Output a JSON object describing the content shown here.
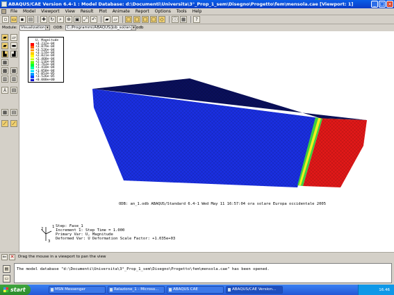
{
  "window": {
    "title": "ABAQUS/CAE Version 6.4-1 : Model Database: d:\\Documenti\\Universita\\3°_Prop_1_sem\\Disegno\\Progetto\\fem\\mensola.cae [Viewport: 1]"
  },
  "menu": [
    "File",
    "Model",
    "Viewport",
    "View",
    "Result",
    "Plot",
    "Animate",
    "Report",
    "Options",
    "Tools",
    "Help"
  ],
  "toolbar": {
    "help_icon": "?"
  },
  "module": {
    "label": "Module:",
    "value": "Visualization",
    "odb_label": "ODB:",
    "odb_value": "C:/Programmi/ABAQUS/Job_sol/an_1.odb"
  },
  "legend": {
    "title": "U, Magnitude",
    "entries": [
      {
        "value": "+4.232e-04",
        "color": "#ff0000"
      },
      {
        "value": "+3.879e-04",
        "color": "#ff5a00"
      },
      {
        "value": "+3.526e-04",
        "color": "#ff9900"
      },
      {
        "value": "+3.174e-04",
        "color": "#ffcc00"
      },
      {
        "value": "+2.821e-04",
        "color": "#ffff00"
      },
      {
        "value": "+2.468e-04",
        "color": "#ccff00"
      },
      {
        "value": "+2.116e-04",
        "color": "#66ff00"
      },
      {
        "value": "+1.763e-04",
        "color": "#00ff33"
      },
      {
        "value": "+1.410e-04",
        "color": "#00ffaa"
      },
      {
        "value": "+1.058e-04",
        "color": "#00e5ff"
      },
      {
        "value": "+7.053e-05",
        "color": "#0099ff"
      },
      {
        "value": "+3.526e-05",
        "color": "#0044ff"
      },
      {
        "value": "+0.000e+00",
        "color": "#0000cc"
      }
    ]
  },
  "info": {
    "odb_line": "ODB: an_1.odb    ABAQUS/Standard 6.4-1    Wed May 11 16:57:04 ora solare Europa occidentale 2005",
    "step_line": "Step: Fase_1",
    "increment_line": "Increment    1: Step Time =    1.000",
    "primary_line": "Primary Var: U, Magnitude",
    "deformed_line": "Deformed Var: U   Deformation Scale Factor: +1.035e+03"
  },
  "triad": {
    "x": "1",
    "y": "2",
    "z": "3"
  },
  "prompt": {
    "text": "Drag the mouse in a viewport to pan the view"
  },
  "message": "The model database \"d:\\Documenti\\Universita\\3°_Prop_1_sem\\Disegno\\Progetto\\fem\\mensola.cae\" has been opened.",
  "taskbar": {
    "start": "start",
    "tasks": [
      "MSN Messenger",
      "Relazione_1 - Microso...",
      "ABAQUS CAE",
      "ABAQUS/CAE Version..."
    ],
    "clock": "16.46"
  },
  "colors": {
    "mesh_blue": "#1a2fe0",
    "mesh_red": "#e01818",
    "title_blue": "#0b4fd8"
  }
}
